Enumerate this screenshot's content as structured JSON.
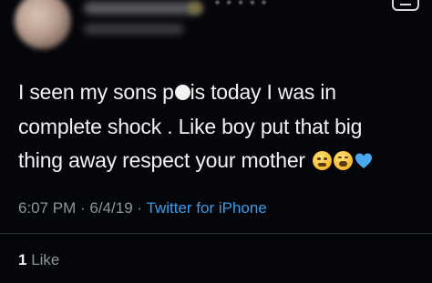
{
  "tweet": {
    "text_line1_pre": "I seen my sons p",
    "text_line1_post": "is today I was in",
    "text_line2": "complete shock . Like boy put that big",
    "text_line3": "thing away respect your mother",
    "emojis": [
      "grimacing-face-emoji",
      "tired-face-emoji",
      "blue-heart-emoji"
    ]
  },
  "meta": {
    "time": "6:07 PM",
    "sep1": " · ",
    "date": "6/4/19",
    "sep2": " · ",
    "source": "Twitter for iPhone"
  },
  "likes": {
    "count": "1",
    "label": " Like"
  },
  "colors": {
    "background": "#05060a",
    "text": "#f2f2f2",
    "muted": "#8e949c",
    "link": "#3b9be8",
    "heart": "#4aa8f0"
  }
}
